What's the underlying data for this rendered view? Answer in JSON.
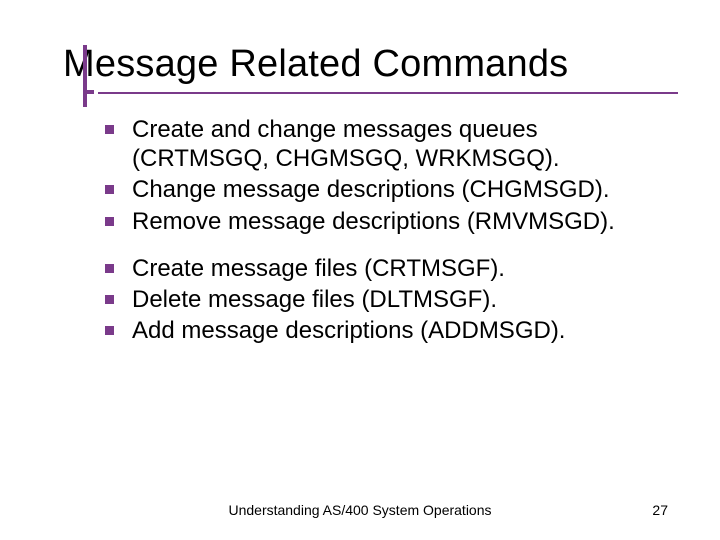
{
  "title": "Message Related Commands",
  "group1": {
    "b0": "Create and change messages queues (CRTMSGQ, CHGMSGQ, WRKMSGQ).",
    "b1": "Change message descriptions (CHGMSGD).",
    "b2": "Remove message descriptions (RMVMSGD)."
  },
  "group2": {
    "b0": "Create message files (CRTMSGF).",
    "b1": "Delete message files (DLTMSGF).",
    "b2": "Add message descriptions (ADDMSGD)."
  },
  "footer": "Understanding AS/400 System Operations",
  "page": "27"
}
